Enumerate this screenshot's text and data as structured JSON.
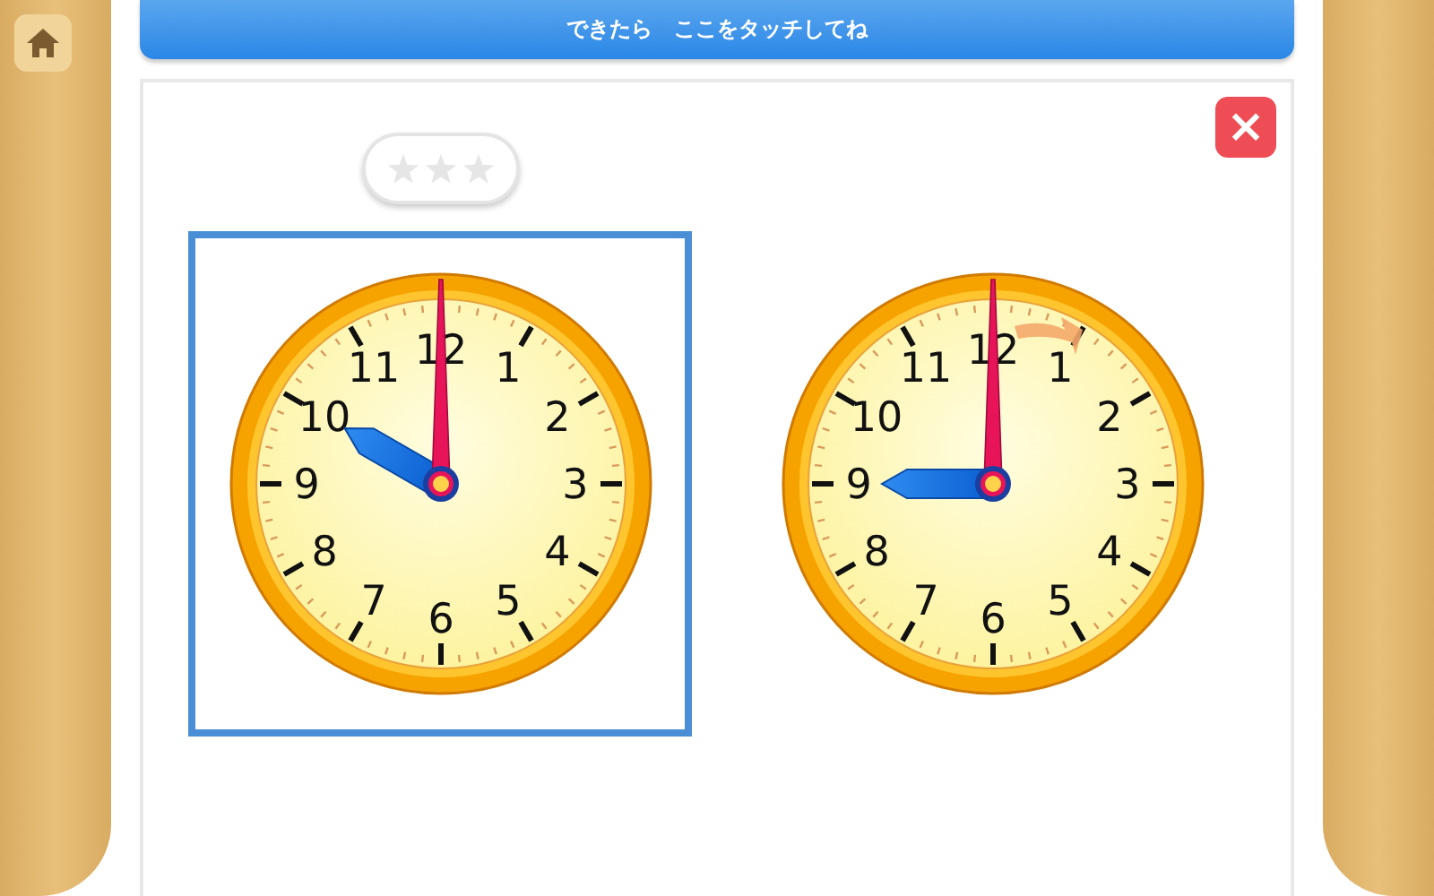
{
  "home_button": {
    "kind": "home"
  },
  "banner": {
    "text": "できたら　ここをタッチしてね"
  },
  "rating": {
    "stars": 0,
    "slots": [
      {
        "kind": "star"
      },
      {
        "kind": "star"
      },
      {
        "kind": "star"
      }
    ]
  },
  "close_button": {
    "label": "×"
  },
  "clocks": [
    {
      "selected": true,
      "hint_arrow": false,
      "hour_hand": {
        "kind": "ten"
      },
      "minute_hand": {
        "kind": "twelve"
      },
      "numerals": [
        "11",
        "12",
        "1",
        "10",
        "2",
        "9",
        "3",
        "8",
        "4",
        "7",
        "6",
        "5"
      ]
    },
    {
      "selected": false,
      "hint_arrow": true,
      "hour_hand": {
        "kind": "nine"
      },
      "minute_hand": {
        "kind": "twelve"
      },
      "numerals": [
        "11",
        "12",
        "1",
        "10",
        "2",
        "9",
        "3",
        "8",
        "4",
        "7",
        "6",
        "5"
      ]
    }
  ]
}
